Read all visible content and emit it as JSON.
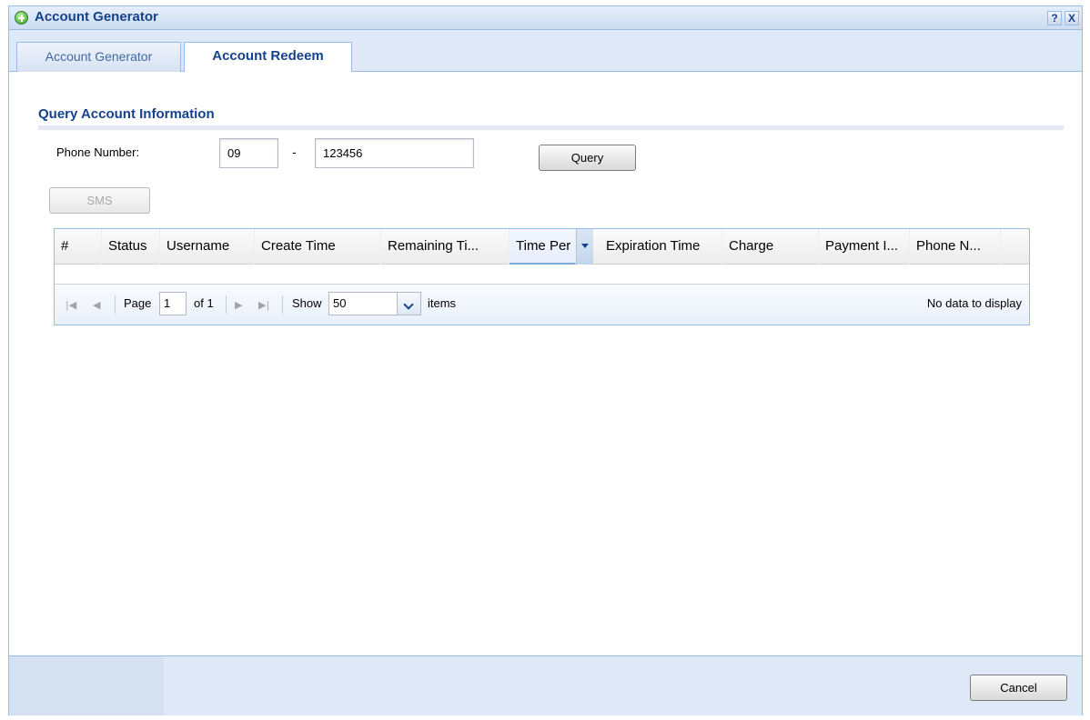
{
  "window": {
    "title": "Account Generator",
    "help_label": "?",
    "close_label": "X"
  },
  "tabs": [
    {
      "label": "Account Generator",
      "active": false
    },
    {
      "label": "Account Redeem",
      "active": true
    }
  ],
  "query_section": {
    "title": "Query Account Information",
    "phone_label": "Phone Number:",
    "phone_prefix_value": "09",
    "separator": "-",
    "phone_number_value": "123456",
    "query_button": "Query",
    "sms_button": "SMS"
  },
  "grid": {
    "columns": [
      "#",
      "Status",
      "Username",
      "Create Time",
      "Remaining Ti...",
      "Time Per",
      "Expiration Time",
      "Charge",
      "Payment I...",
      "Phone N..."
    ],
    "sorted_column": "Time Per",
    "rows": []
  },
  "paging": {
    "page_label": "Page",
    "page_value": "1",
    "of_label": "of 1",
    "show_label": "Show",
    "page_size": "50",
    "items_label": "items",
    "empty_text": "No data to display"
  },
  "footer": {
    "cancel_button": "Cancel"
  },
  "colors": {
    "title_text": "#15428b",
    "panel_bg": "#dfe8f6",
    "border": "#99bbe8"
  }
}
